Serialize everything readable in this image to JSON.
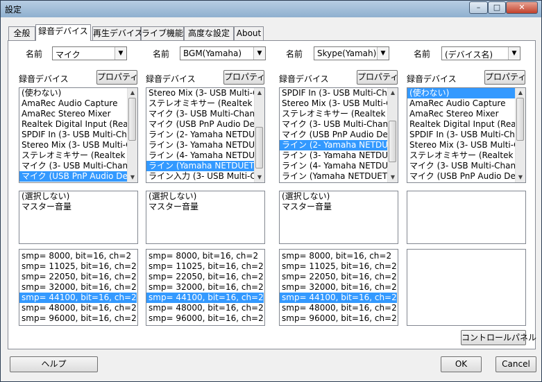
{
  "window": {
    "title": "設定",
    "controls": {
      "minimize": "–",
      "maximize": "□",
      "close": "✕"
    }
  },
  "tabs": [
    {
      "label": "全般",
      "active": false
    },
    {
      "label": "録音デバイス",
      "active": true
    },
    {
      "label": "再生デバイス",
      "active": false
    },
    {
      "label": "ライブ機能",
      "active": false
    },
    {
      "label": "高度な設定",
      "active": false
    },
    {
      "label": "About",
      "active": false
    }
  ],
  "common": {
    "name_label": "名前",
    "device_label": "録音デバイス",
    "properties_button": "プロパティ"
  },
  "columns": [
    {
      "name": "マイク",
      "devices": [
        "(使わない)",
        "AmaRec Audio Capture",
        "AmaRec Stereo Mixer",
        "Realtek Digital Input (Realtek",
        "SPDIF In (3- USB Multi-Chan",
        "Stereo Mix (3- USB Multi-Ch",
        "ステレオミキサー (Realtek High",
        "マイク (3- USB Multi-Channel",
        "マイク (USB PnP Audio Device"
      ],
      "device_selected": 8,
      "mixers": [
        "(選択しない)",
        "マスター音量"
      ],
      "formats": [
        "smp=  8000, bit=16, ch=2",
        "smp= 11025, bit=16, ch=2",
        "smp= 22050, bit=16, ch=2",
        "smp= 32000, bit=16, ch=2",
        "smp= 44100, bit=16, ch=2",
        "smp= 48000, bit=16, ch=2",
        "smp= 96000, bit=16, ch=2"
      ],
      "format_selected": 4
    },
    {
      "name": "BGM(Yamaha)",
      "devices": [
        "Stereo Mix (3- USB Multi-Ch",
        "ステレオミキサー (Realtek High",
        "マイク (3- USB Multi-Channel",
        "マイク (USB PnP Audio Device",
        "ライン (2- Yamaha NETDUET",
        "ライン (3- Yamaha NETDUET",
        "ライン (4- Yamaha NETDUET",
        "ライン (Yamaha NETDUETTO",
        "ライン入力 (3- USB Multi-Cha"
      ],
      "device_selected": 7,
      "mixers": [
        "(選択しない)",
        "マスター音量"
      ],
      "formats": [
        "smp=  8000, bit=16, ch=2",
        "smp= 11025, bit=16, ch=2",
        "smp= 22050, bit=16, ch=2",
        "smp= 32000, bit=16, ch=2",
        "smp= 44100, bit=16, ch=2",
        "smp= 48000, bit=16, ch=2",
        "smp= 96000, bit=16, ch=2"
      ],
      "format_selected": 4
    },
    {
      "name": "Skype(Yamah)",
      "devices": [
        "SPDIF In (3- USB Multi-Chan",
        "Stereo Mix (3- USB Multi-Ch",
        "ステレオミキサー (Realtek High",
        "マイク (3- USB Multi-Channel",
        "マイク (USB PnP Audio Device",
        "ライン (2- Yamaha NETDUET",
        "ライン (3- Yamaha NETDUET",
        "ライン (4- Yamaha NETDUET",
        "ライン (Yamaha NETDUETTO"
      ],
      "device_selected": 5,
      "mixers": [
        "(選択しない)",
        "マスター音量"
      ],
      "formats": [
        "smp=  8000, bit=16, ch=2",
        "smp= 11025, bit=16, ch=2",
        "smp= 22050, bit=16, ch=2",
        "smp= 32000, bit=16, ch=2",
        "smp= 44100, bit=16, ch=2",
        "smp= 48000, bit=16, ch=2",
        "smp= 96000, bit=16, ch=2"
      ],
      "format_selected": 4
    },
    {
      "name": "(デバイス名)",
      "devices": [
        "(使わない)",
        "AmaRec Audio Capture",
        "AmaRec Stereo Mixer",
        "Realtek Digital Input (Realtek",
        "SPDIF In (3- USB Multi-Chan",
        "Stereo Mix (3- USB Multi-Ch",
        "ステレオミキサー (Realtek High",
        "マイク (3- USB Multi-Channel",
        "マイク (USB PnP Audio Device"
      ],
      "device_selected": 0,
      "mixers": [],
      "formats": [],
      "format_selected": -1
    }
  ],
  "control_panel_button": "コントロールパネル",
  "help_button": "ヘルプ",
  "ok_button": "OK",
  "cancel_button": "Cancel"
}
